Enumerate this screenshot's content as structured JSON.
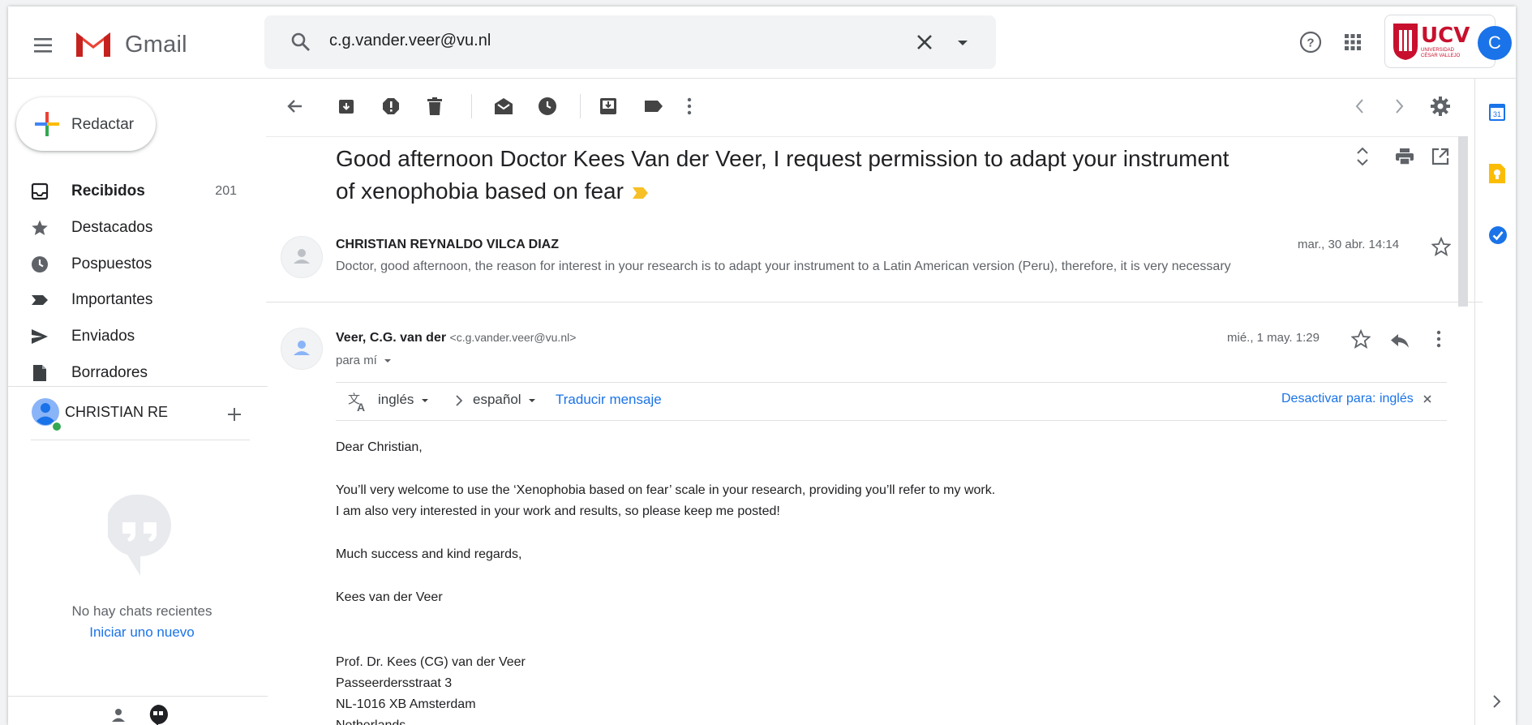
{
  "header": {
    "app_name": "Gmail",
    "search_value": "c.g.vander.veer@vu.nl",
    "org_name": "UCV",
    "org_sub_line1": "UNIVERSIDAD",
    "org_sub_line2": "CÉSAR VALLEJO",
    "avatar_letter": "C",
    "brand_color": "#ea4335",
    "accent_color": "#1a73e8"
  },
  "sidebar": {
    "compose_label": "Redactar",
    "items": [
      {
        "label": "Recibidos",
        "count": "201",
        "icon": "inbox-icon"
      },
      {
        "label": "Destacados",
        "count": "",
        "icon": "star-icon"
      },
      {
        "label": "Pospuestos",
        "count": "",
        "icon": "clock-icon"
      },
      {
        "label": "Importantes",
        "count": "",
        "icon": "important-icon"
      },
      {
        "label": "Enviados",
        "count": "",
        "icon": "send-icon"
      },
      {
        "label": "Borradores",
        "count": "",
        "icon": "draft-icon"
      }
    ],
    "chat_user": "CHRISTIAN RE",
    "no_chats": "No hay chats recientes",
    "start_new": "Iniciar uno nuevo"
  },
  "thread": {
    "subject": "Good afternoon Doctor Kees Van der Veer, I request permission to adapt your instrument of xenophobia based on fear",
    "messages": [
      {
        "sender": "CHRISTIAN REYNALDO VILCA DIAZ",
        "snippet": "Doctor, good afternoon, the reason for interest in your research is to adapt your instrument to a Latin American version (Peru), therefore, it is very necessary",
        "date": "mar., 30 abr. 14:14"
      },
      {
        "sender": "Veer, C.G. van der",
        "sender_email": "<c.g.vander.veer@vu.nl>",
        "to": "para mí",
        "date": "mié., 1 may. 1:29"
      }
    ],
    "translate": {
      "source_lang": "inglés",
      "target_lang": "español",
      "translate_link": "Traducir mensaje",
      "disable_link": "Desactivar para: inglés"
    },
    "body": [
      "Dear Christian,",
      "You’ll very welcome to use the ‘Xenophobia based on fear’ scale in your research, providing you’ll refer to my work.",
      "I am also very interested in your work and results, so please keep me posted!",
      "Much success and kind regards,",
      "Kees van der Veer",
      "Prof. Dr. Kees (CG) van der Veer",
      "Passeerdersstraat 3",
      "NL-1016 XB Amsterdam",
      "Netherlands"
    ]
  }
}
